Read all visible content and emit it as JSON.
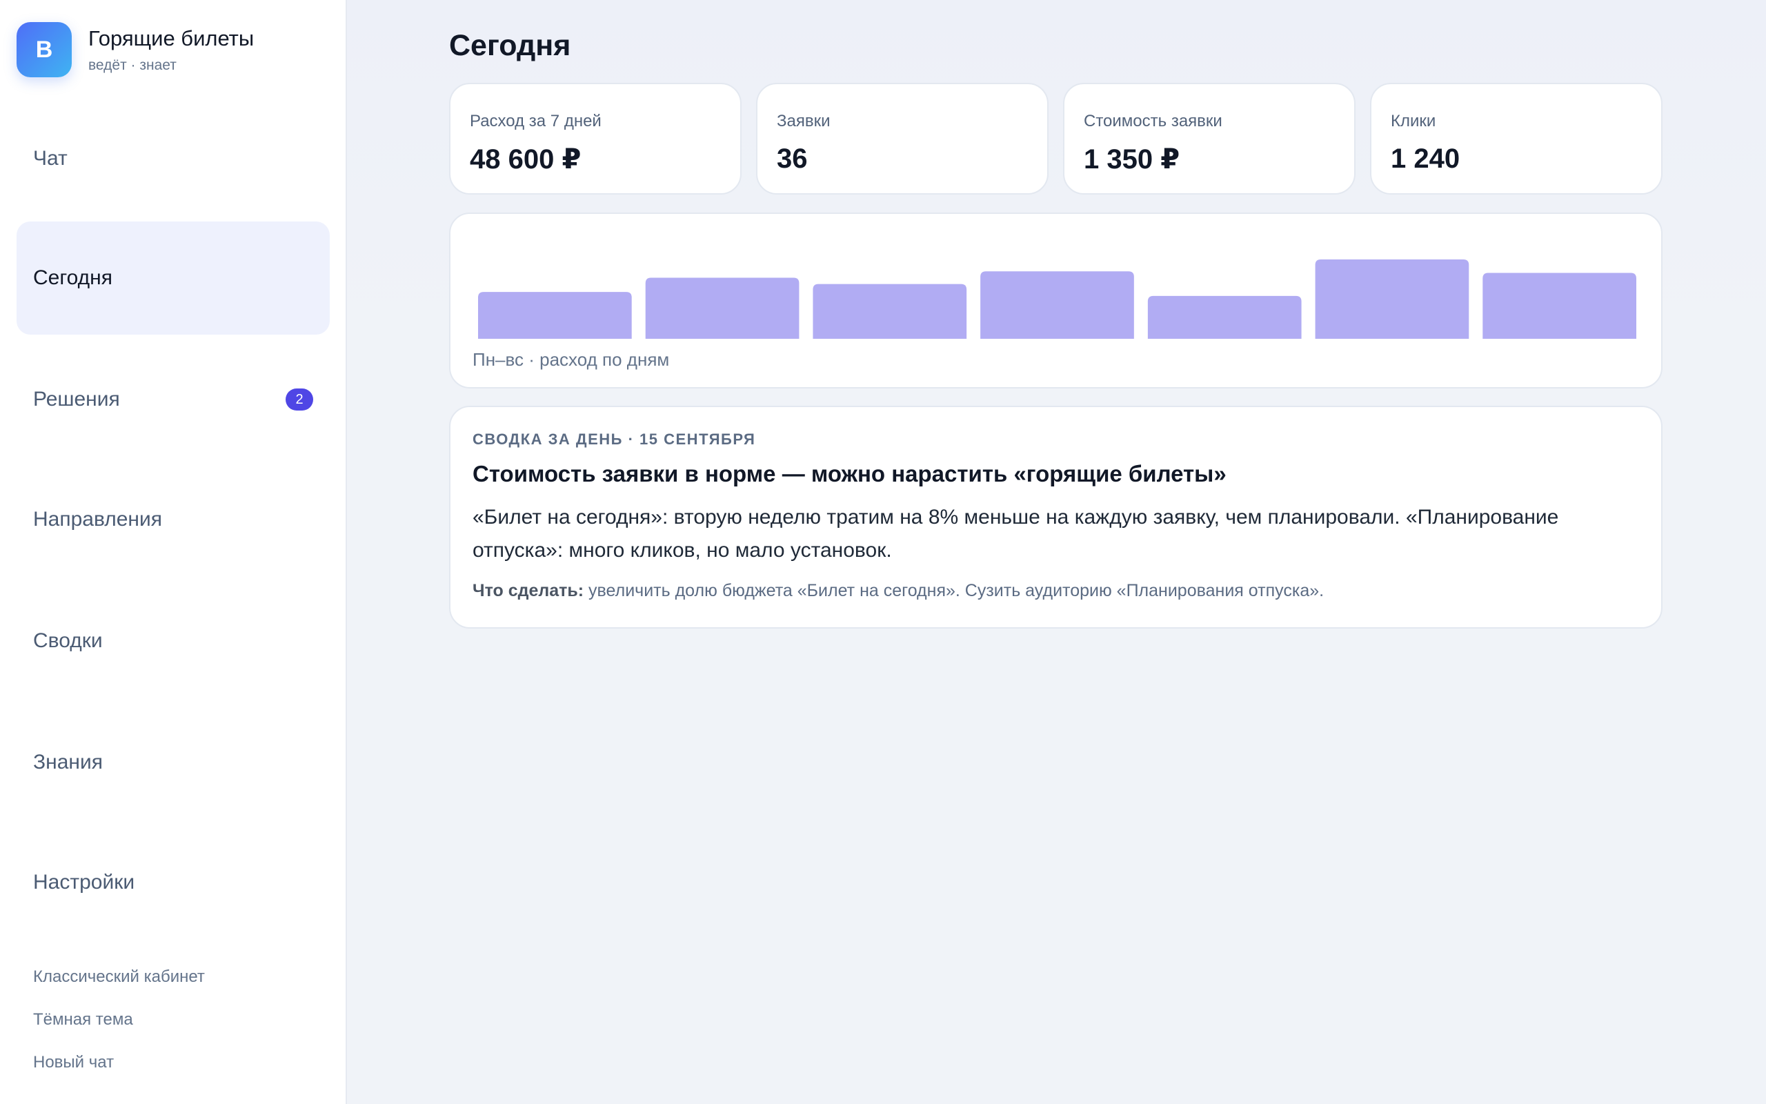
{
  "brand": {
    "logo_letter": "B",
    "title": "Горящие билеты",
    "subtitle": "ведёт · знает"
  },
  "nav": [
    {
      "label": "Чат",
      "active": false
    },
    {
      "label": "Сегодня",
      "active": true
    },
    {
      "label": "Решения",
      "active": false,
      "badge": "2"
    },
    {
      "label": "Направления",
      "active": false
    },
    {
      "label": "Сводки",
      "active": false
    },
    {
      "label": "Знания",
      "active": false
    },
    {
      "label": "Настройки",
      "active": false
    }
  ],
  "bottom_links": [
    "Классический кабинет",
    "Тёмная тема",
    "Новый чат"
  ],
  "page": {
    "title": "Сегодня"
  },
  "kpis": [
    {
      "label": "Расход за 7 дней",
      "value": "48 600 ₽"
    },
    {
      "label": "Заявки",
      "value": "36"
    },
    {
      "label": "Стоимость заявки",
      "value": "1 350 ₽"
    },
    {
      "label": "Клики",
      "value": "1 240"
    }
  ],
  "chart_data": {
    "type": "bar",
    "categories": [],
    "values": [
      0.59,
      0.77,
      0.69,
      0.85,
      0.54,
      1.0,
      0.83
    ],
    "title": "",
    "caption": "Пн–вс · расход по дням",
    "bar_color": "#b1acf3"
  },
  "summary": {
    "kicker": "СВОДКА ЗА ДЕНЬ · 15 СЕНТЯБРЯ",
    "title": "Стоимость заявки в норме — можно нарастить «горящие билеты»",
    "body": "«Билет на сегодня»: вторую неделю тратим на 8% меньше на каждую заявку, чем планировали. «Планирование отпуска»: много кликов, но мало установок.",
    "action_label": "Что сделать:",
    "action_text": " увеличить долю бюджета «Билет на сегодня». Сузить аудиторию «Планирования отпуска»."
  },
  "colors": {
    "accent": "#4f46e5",
    "active_nav_bg": "#eef1fd",
    "bars": "#b1acf3"
  }
}
